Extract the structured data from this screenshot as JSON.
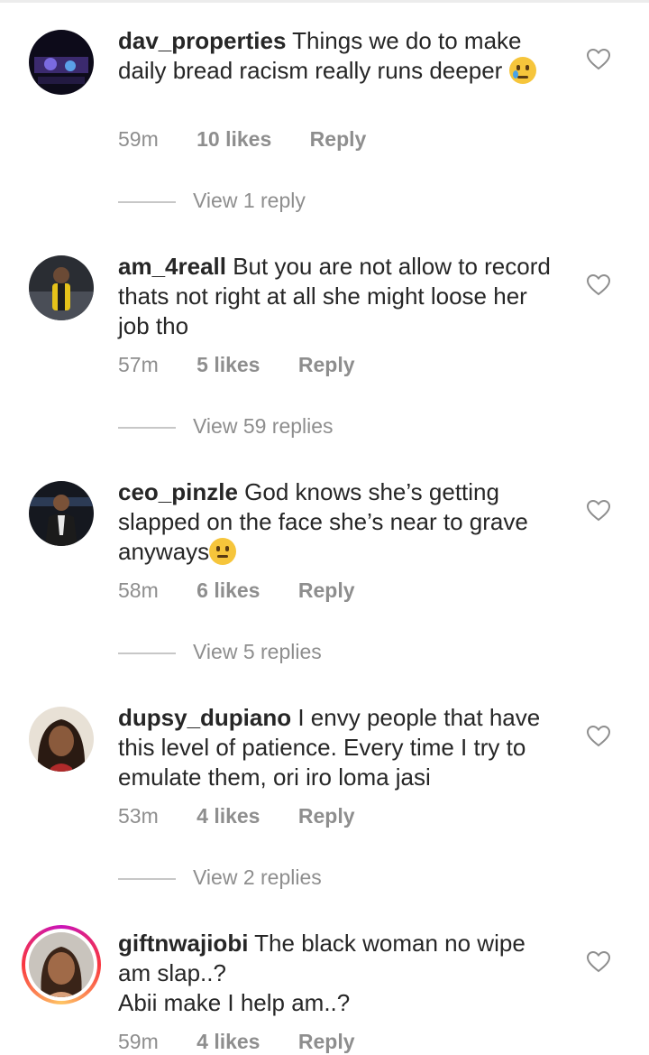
{
  "comments": [
    {
      "username": "dav_properties",
      "text": " Things we do to make daily bread racism really runs deeper ",
      "emoji": "crying-face-emoji",
      "time": "59m",
      "likes": "10 likes",
      "reply": "Reply",
      "view_replies": "View 1 reply"
    },
    {
      "username": "am_4reall",
      "text": " But you are not allow to record thats not right at all she might loose her job tho",
      "time": "57m",
      "likes": "5 likes",
      "reply": "Reply",
      "view_replies": "View 59 replies"
    },
    {
      "username": "ceo_pinzle",
      "text": " God knows she’s getting slapped on the face she’s near to grave anyways",
      "emoji": "neutral-face-emoji",
      "time": "58m",
      "likes": "6 likes",
      "reply": "Reply",
      "view_replies": "View 5 replies"
    },
    {
      "username": "dupsy_dupiano",
      "text": " I envy people that have this level of patience. Every time I try to emulate them, ori iro loma jasi",
      "time": "53m",
      "likes": "4 likes",
      "reply": "Reply",
      "view_replies": "View 2 replies"
    },
    {
      "username": "giftnwajiobi",
      "text": " The black woman no wipe am slap..?",
      "text2": "Abii make I help am..?",
      "time": "59m",
      "likes": "4 likes",
      "reply": "Reply"
    }
  ],
  "colors": {
    "primary_text": "#262626",
    "secondary_text": "#8e8e8e",
    "divider": "#c7c7c7",
    "story_ring": [
      "#c913b9",
      "#f9373f",
      "#fec564"
    ]
  }
}
